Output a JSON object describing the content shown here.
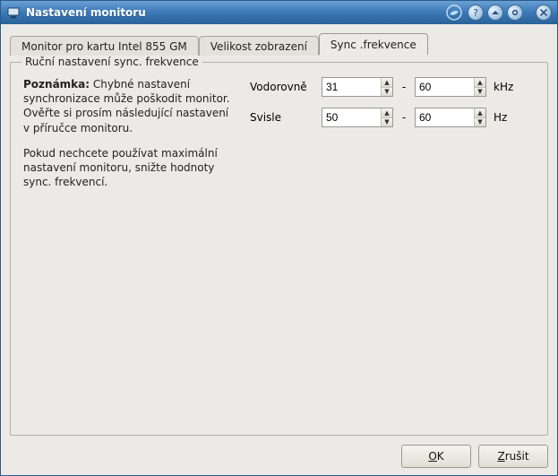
{
  "window": {
    "title": "Nastavení monitoru"
  },
  "tabs": {
    "monitor": "Monitor pro kartu Intel 855 GM",
    "size": "Velikost zobrazení",
    "sync": "Sync .frekvence"
  },
  "group": {
    "legend": "Ruční nastavení sync. frekvence",
    "note_label": "Poznámka:",
    "note_text": " Chybné nastavení synchronizace může poškodit monitor. Ověřte si prosím následující nastavení v příručce monitoru.",
    "note_para2": "Pokud nechcete používat maximální nastavení monitoru, snižte hodnoty sync. frekvencí."
  },
  "fields": {
    "horiz_label": "Vodorovně",
    "horiz_min": "31",
    "horiz_max": "60",
    "horiz_unit": "kHz",
    "vert_label": "Svisle",
    "vert_min": "50",
    "vert_max": "60",
    "vert_unit": "Hz",
    "dash": "-"
  },
  "buttons": {
    "ok_pre": "",
    "ok_mn": "O",
    "ok_post": "K",
    "cancel_pre": "",
    "cancel_mn": "Z",
    "cancel_post": "rušit"
  }
}
